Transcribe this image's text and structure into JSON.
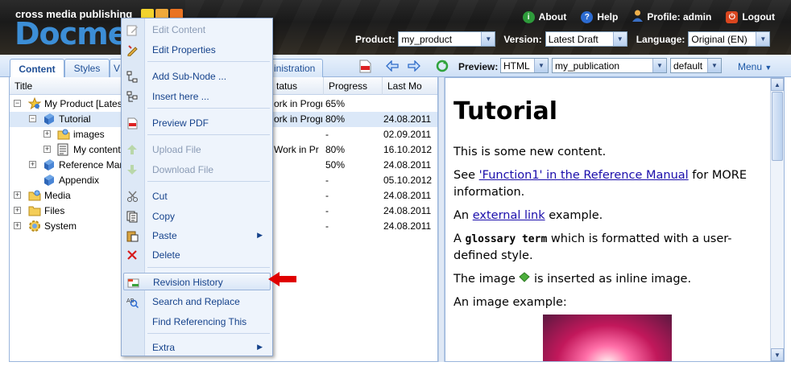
{
  "brand": {
    "small": "cross media publishing",
    "big": "Docme"
  },
  "top_links": [
    {
      "label": "About",
      "icon": "info-icon",
      "color": "#2e9b3b"
    },
    {
      "label": "Help",
      "icon": "help-icon",
      "color": "#2c6bd1"
    },
    {
      "label": "Profile: admin",
      "icon": "user-icon",
      "color": "#e8a33a"
    },
    {
      "label": "Logout",
      "icon": "power-icon",
      "color": "#d9461f"
    }
  ],
  "selectors": {
    "product_label": "Product:",
    "product_value": "my_product",
    "version_label": "Version:",
    "version_value": "Latest Draft",
    "language_label": "Language:",
    "language_value": "Original (EN)"
  },
  "tabs": [
    "Content",
    "Styles",
    "V",
    "inistration"
  ],
  "toolbar": {
    "preview_label": "Preview:",
    "format_value": "HTML",
    "publication_value": "my_publication",
    "style_value": "default",
    "menu_label": "Menu"
  },
  "grid": {
    "columns": [
      "Title",
      "tatus",
      "Progress",
      "Last Mo"
    ],
    "rows": [
      {
        "title": "My Product [Lates",
        "status": "ork in Progr",
        "progress": "65%",
        "date": ""
      },
      {
        "title": "Tutorial",
        "status": "ork in Progr",
        "progress": "80%",
        "date": "24.08.2011"
      },
      {
        "title": "images",
        "status": "",
        "progress": "-",
        "date": "02.09.2011"
      },
      {
        "title": "My content",
        "status": "Work in Pr",
        "progress": "80%",
        "date": "16.10.2012"
      },
      {
        "title": "Reference Mar",
        "status": "",
        "progress": "50%",
        "date": "24.08.2011"
      },
      {
        "title": "Appendix",
        "status": "",
        "progress": "-",
        "date": "05.10.2012"
      },
      {
        "title": "Media",
        "status": "",
        "progress": "-",
        "date": "24.08.2011"
      },
      {
        "title": "Files",
        "status": "",
        "progress": "-",
        "date": "24.08.2011"
      },
      {
        "title": "System",
        "status": "",
        "progress": "-",
        "date": "24.08.2011"
      }
    ]
  },
  "context_menu": {
    "items": [
      {
        "label": "Edit Content",
        "icon": "edit-icon",
        "disabled": true
      },
      {
        "label": "Edit Properties",
        "icon": "properties-icon",
        "disabled": false
      },
      {
        "label": "Add Sub-Node ...",
        "icon": "add-subnode-icon",
        "disabled": false
      },
      {
        "label": "Insert here ...",
        "icon": "insert-icon",
        "disabled": false
      },
      {
        "label": "Preview PDF",
        "icon": "pdf-icon",
        "disabled": false
      },
      {
        "label": "Upload File",
        "icon": "upload-icon",
        "disabled": true
      },
      {
        "label": "Download File",
        "icon": "download-icon",
        "disabled": true
      },
      {
        "label": "Cut",
        "icon": "cut-icon",
        "disabled": false
      },
      {
        "label": "Copy",
        "icon": "copy-icon",
        "disabled": false
      },
      {
        "label": "Paste",
        "icon": "paste-icon",
        "disabled": false
      },
      {
        "label": "Delete",
        "icon": "delete-icon",
        "disabled": false
      },
      {
        "label": "Revision History",
        "icon": "revision-history-icon",
        "disabled": false,
        "highlighted": true
      },
      {
        "label": "Search and Replace",
        "icon": "search-replace-icon",
        "disabled": false
      },
      {
        "label": "Find Referencing This",
        "icon": "find-references-icon",
        "disabled": false
      },
      {
        "label": "Extra",
        "icon": "",
        "disabled": false
      }
    ]
  },
  "preview": {
    "heading": "Tutorial",
    "p1": "This is some new content.",
    "p2_prefix": "See ",
    "p2_link": "'Function1' in the Reference Manual",
    "p2_suffix": " for MORE information.",
    "p3_prefix": "An ",
    "p3_link": "external link",
    "p3_suffix": " example.",
    "p4_prefix": "A ",
    "p4_term": "glossary term",
    "p4_suffix": " which is formatted with a user-defined style.",
    "p5_prefix": "The image ",
    "p5_suffix": " is inserted as inline image.",
    "p6": "An image example:"
  },
  "colors": {
    "accent": "#3c8ed6",
    "menu_text": "#15428b",
    "link": "#1a0dab",
    "arrow": "#e00000"
  }
}
